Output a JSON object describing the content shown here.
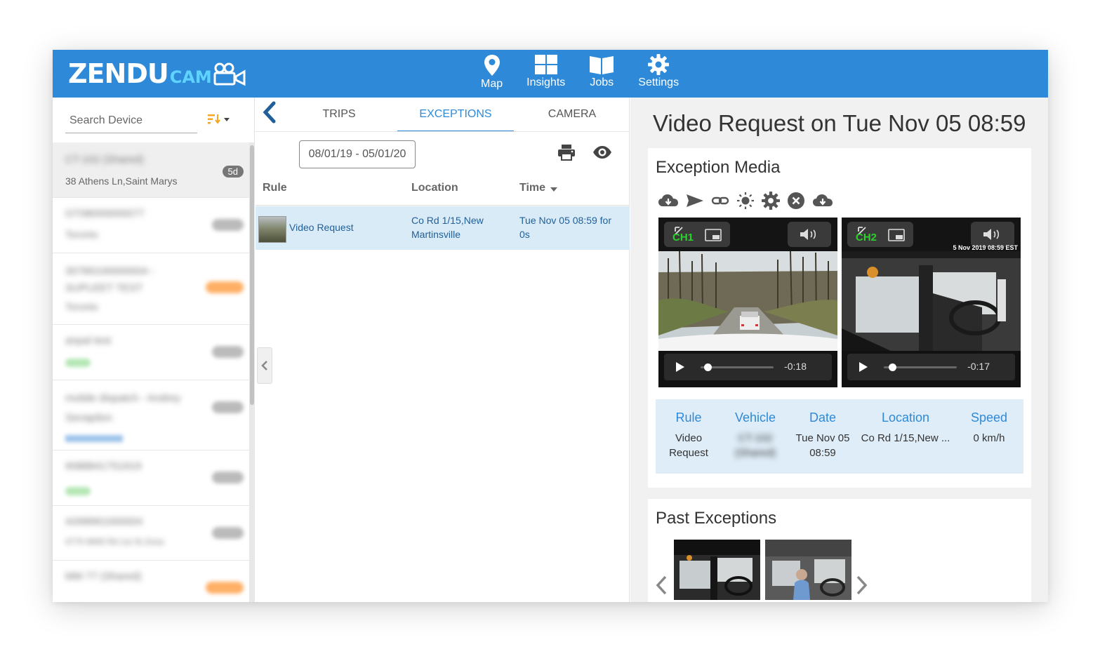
{
  "app": {
    "logo_main": "ZENDU",
    "logo_sub": "CAM"
  },
  "nav": [
    {
      "label": "Map",
      "icon": "map-pin-icon"
    },
    {
      "label": "Insights",
      "icon": "grid-icon"
    },
    {
      "label": "Jobs",
      "icon": "book-icon"
    },
    {
      "label": "Settings",
      "icon": "gear-icon"
    }
  ],
  "sidebar": {
    "search_placeholder": "Search Device",
    "devices": [
      {
        "name": "CT-102 (Shared)",
        "address": "38 Athens Ln,Saint Marys",
        "badge": "5d",
        "selected": true
      },
      {
        "name": "GT08000000077",
        "address": "Toronto",
        "badge": "420d"
      },
      {
        "name": "3078910000000A - SUPLEET TEST",
        "address": "Toronto",
        "badge": "Online"
      },
      {
        "name": "anpal test",
        "address": "offline",
        "badge": "420d"
      },
      {
        "name": "mobile dispatch - Andrey Senapilon",
        "address": "Toronto",
        "badge": "420d"
      },
      {
        "name": "9088841751919",
        "address": "offline",
        "badge": "420d"
      },
      {
        "name": "A098961000004",
        "address": "4770 6600 Rd 1st St Zona",
        "badge": "420d"
      },
      {
        "name": "MM 77 (Shared)",
        "address": "",
        "badge": "Online"
      }
    ]
  },
  "middle": {
    "tabs": [
      "TRIPS",
      "EXCEPTIONS",
      "CAMERA"
    ],
    "active_tab": "EXCEPTIONS",
    "date_range": "08/01/19 - 05/01/20",
    "columns": {
      "rule": "Rule",
      "location": "Location",
      "time": "Time"
    },
    "rows": [
      {
        "rule": "Video Request",
        "location_line1": "Co Rd 1/15,New",
        "location_line2": "Martinsville",
        "time_line1": "Tue Nov 05 08:59 for",
        "time_line2": "0s"
      }
    ]
  },
  "detail": {
    "title": "Video Request on Tue Nov 05 08:59",
    "media_title": "Exception Media",
    "videos": [
      {
        "channel": "CH1",
        "remaining": "-0:18",
        "progress": 0.1
      },
      {
        "channel": "CH2",
        "remaining": "-0:17",
        "progress": 0.12,
        "overlay": "5 Nov 2019 08:59 EST"
      }
    ],
    "info": {
      "headers": {
        "rule": "Rule",
        "vehicle": "Vehicle",
        "date": "Date",
        "location": "Location",
        "speed": "Speed"
      },
      "rule_line1": "Video",
      "rule_line2": "Request",
      "vehicle_line1": "CT-102",
      "vehicle_line2": "(Shared)",
      "date_line1": "Tue Nov 05",
      "date_line2": "08:59",
      "location": "Co Rd 1/15,New ...",
      "speed": "0 km/h"
    },
    "past_title": "Past Exceptions"
  },
  "colors": {
    "header_blue": "#2e8ad8",
    "selected_row": "#d9ebf7",
    "info_box": "#dfedf8"
  }
}
